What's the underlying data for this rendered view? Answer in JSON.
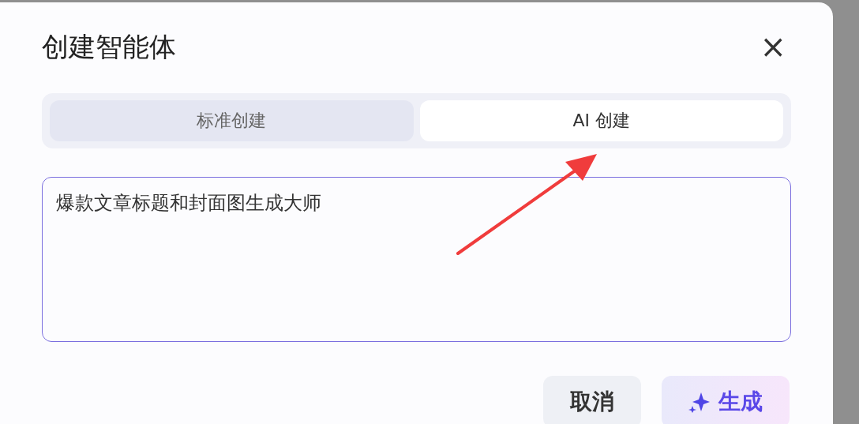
{
  "dialog": {
    "title": "创建智能体",
    "close": "×"
  },
  "tabs": [
    {
      "label": "标准创建",
      "selected": false
    },
    {
      "label": "AI 创建",
      "selected": true
    }
  ],
  "prompt": {
    "value": "爆款文章标题和封面图生成大师"
  },
  "buttons": [
    {
      "label": "取消",
      "kind": "secondary"
    },
    {
      "label": "生成",
      "kind": "primary"
    }
  ]
}
